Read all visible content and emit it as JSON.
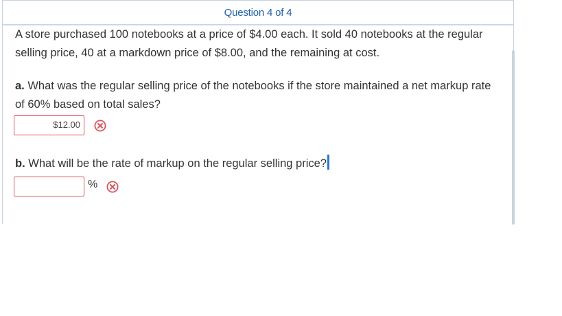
{
  "header": {
    "title": "Question 4 of 4"
  },
  "problem": {
    "text": "A store purchased 100 notebooks at a price of $4.00 each. It sold 40 notebooks at the regular selling price, 40 at a markdown price of $8.00, and the remaining at cost."
  },
  "part_a": {
    "label": "a.",
    "question": "What was the regular selling price of the notebooks if the store maintained a net markup rate of 60% based on total sales?",
    "answer_value": "$12.00",
    "status": "incorrect"
  },
  "part_b": {
    "label": "b.",
    "question": "What will be the rate of markup on the regular selling price?",
    "answer_value": "",
    "unit": "%",
    "status": "incorrect"
  },
  "colors": {
    "title": "#1f5fb0",
    "error": "#e0525a",
    "cursor": "#2176e0"
  }
}
